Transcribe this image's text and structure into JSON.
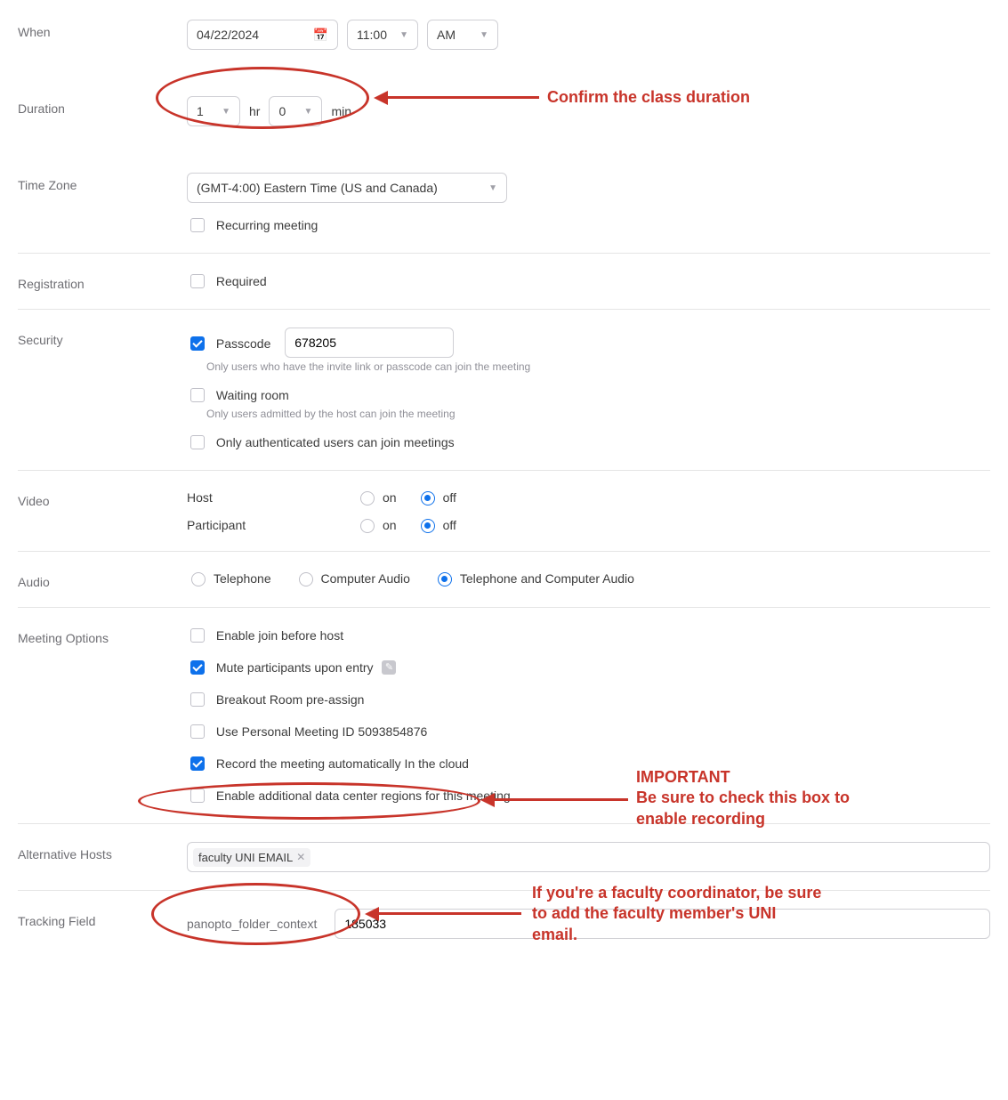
{
  "when": {
    "label": "When",
    "date": "04/22/2024",
    "time": "11:00",
    "ampm": "AM"
  },
  "duration": {
    "label": "Duration",
    "hr_value": "1",
    "hr_unit": "hr",
    "min_value": "0",
    "min_unit": "min"
  },
  "timezone": {
    "label": "Time Zone",
    "value": "(GMT-4:00) Eastern Time (US and Canada)",
    "recurring_label": "Recurring meeting"
  },
  "registration": {
    "label": "Registration",
    "required_label": "Required"
  },
  "security": {
    "label": "Security",
    "passcode_label": "Passcode",
    "passcode_value": "678205",
    "passcode_help": "Only users who have the invite link or passcode can join the meeting",
    "waiting_label": "Waiting room",
    "waiting_help": "Only users admitted by the host can join the meeting",
    "auth_label": "Only authenticated users can join meetings"
  },
  "video": {
    "label": "Video",
    "host_label": "Host",
    "participant_label": "Participant",
    "on": "on",
    "off": "off"
  },
  "audio": {
    "label": "Audio",
    "telephone": "Telephone",
    "computer": "Computer Audio",
    "both": "Telephone and Computer Audio"
  },
  "options": {
    "label": "Meeting Options",
    "join_before": "Enable join before host",
    "mute": "Mute participants upon entry",
    "breakout": "Breakout Room pre-assign",
    "pmi": "Use Personal Meeting ID 5093854876",
    "record": "Record the meeting automatically In the cloud",
    "datacenter": "Enable additional data center regions for this meeting"
  },
  "alt_hosts": {
    "label": "Alternative Hosts",
    "tag": "faculty UNI EMAIL"
  },
  "tracking": {
    "label": "Tracking Field",
    "field_name": "panopto_folder_context",
    "value": "185033"
  },
  "annotations": {
    "duration": "Confirm the class duration",
    "record_title": "IMPORTANT",
    "record_body": "Be sure to check this box to enable recording",
    "alt_hosts": "If you're a faculty coordinator, be sure to add the faculty member's UNI email."
  }
}
